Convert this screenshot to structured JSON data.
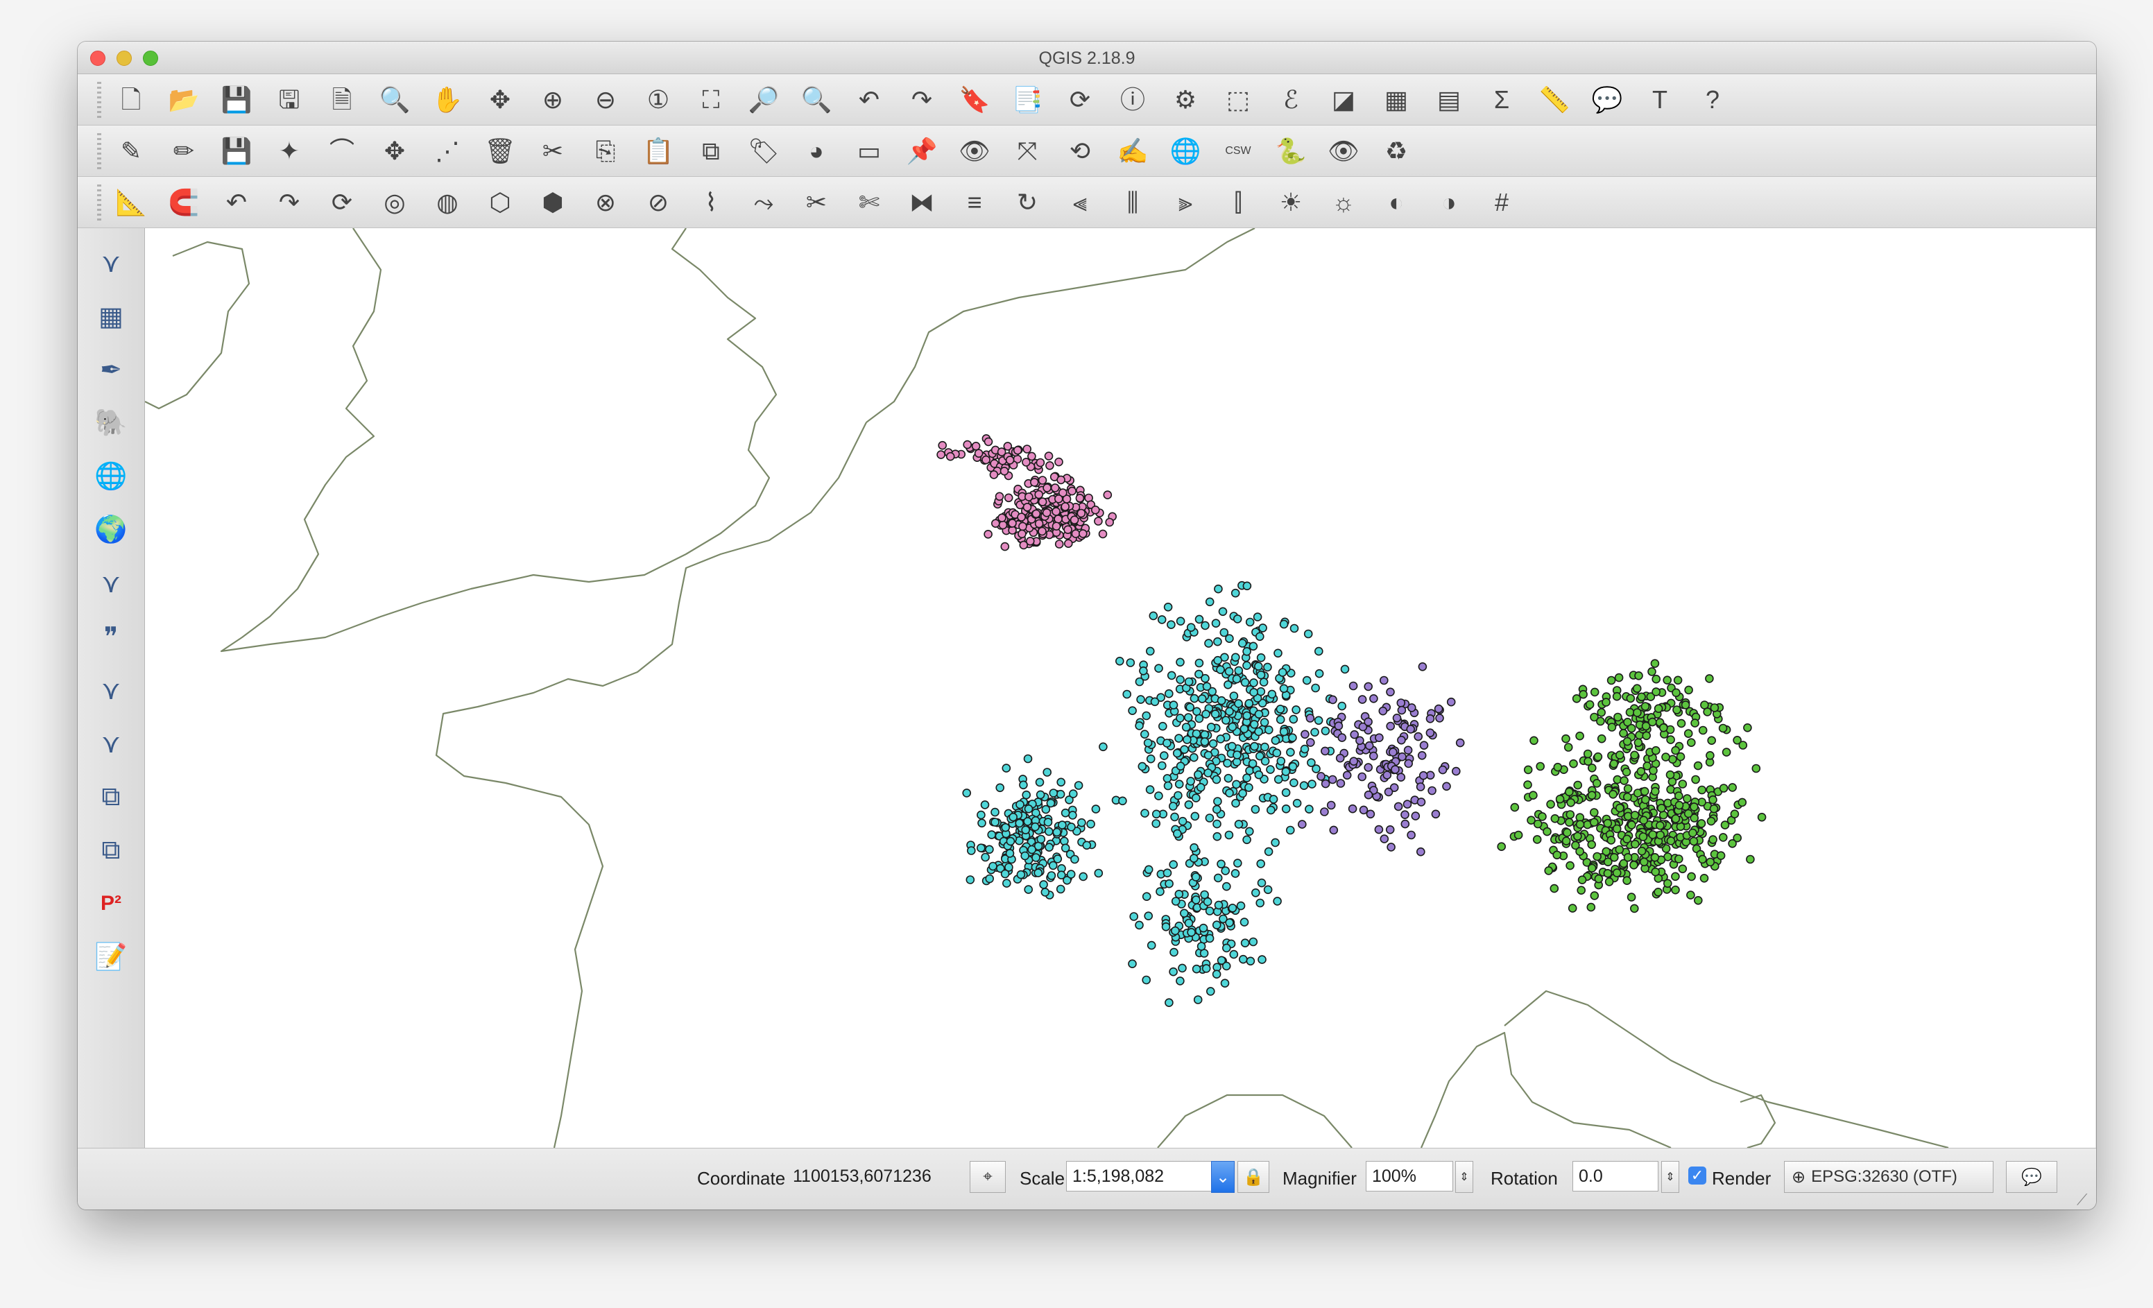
{
  "window": {
    "title": "QGIS 2.18.9"
  },
  "toolbar_file": [
    {
      "name": "new-project-icon",
      "glyph": "🗋"
    },
    {
      "name": "open-project-icon",
      "glyph": "📂"
    },
    {
      "name": "save-project-icon",
      "glyph": "💾"
    },
    {
      "name": "save-as-icon",
      "glyph": "🖫"
    },
    {
      "name": "new-print-composer-icon",
      "glyph": "🗎"
    },
    {
      "name": "composer-manager-icon",
      "glyph": "🔍"
    },
    {
      "name": "pan-map-icon",
      "glyph": "✋"
    },
    {
      "name": "pan-to-selection-icon",
      "glyph": "✥"
    },
    {
      "name": "zoom-in-icon",
      "glyph": "⊕"
    },
    {
      "name": "zoom-out-icon",
      "glyph": "⊖"
    },
    {
      "name": "zoom-native-icon",
      "glyph": "①"
    },
    {
      "name": "zoom-full-icon",
      "glyph": "⛶"
    },
    {
      "name": "zoom-to-selection-icon",
      "glyph": "🔎"
    },
    {
      "name": "zoom-to-layer-icon",
      "glyph": "🔍"
    },
    {
      "name": "zoom-last-icon",
      "glyph": "↶"
    },
    {
      "name": "zoom-next-icon",
      "glyph": "↷"
    },
    {
      "name": "new-bookmark-icon",
      "glyph": "🔖"
    },
    {
      "name": "show-bookmarks-icon",
      "glyph": "📑"
    },
    {
      "name": "refresh-icon",
      "glyph": "⟳"
    },
    {
      "name": "identify-icon",
      "glyph": "ⓘ"
    },
    {
      "name": "run-feature-action-icon",
      "glyph": "⚙"
    },
    {
      "name": "select-features-icon",
      "glyph": "⬚"
    },
    {
      "name": "select-by-expression-icon",
      "glyph": "ℰ"
    },
    {
      "name": "deselect-all-icon",
      "glyph": "◪"
    },
    {
      "name": "attribute-table-icon",
      "glyph": "▦"
    },
    {
      "name": "field-calculator-icon",
      "glyph": "▤"
    },
    {
      "name": "statistics-icon",
      "glyph": "Σ"
    },
    {
      "name": "measure-icon",
      "glyph": "📏"
    },
    {
      "name": "map-tips-icon",
      "glyph": "💬"
    },
    {
      "name": "text-annotation-icon",
      "glyph": "T"
    },
    {
      "name": "help-icon",
      "glyph": "?"
    }
  ],
  "toolbar_edit": [
    {
      "name": "current-edits-icon",
      "glyph": "✎"
    },
    {
      "name": "toggle-editing-icon",
      "glyph": "✏"
    },
    {
      "name": "save-edits-icon",
      "glyph": "💾"
    },
    {
      "name": "add-feature-icon",
      "glyph": "✦"
    },
    {
      "name": "add-circular-string-icon",
      "glyph": "⌒"
    },
    {
      "name": "move-feature-icon",
      "glyph": "✥"
    },
    {
      "name": "node-tool-icon",
      "glyph": "⋰"
    },
    {
      "name": "delete-selected-icon",
      "glyph": "🗑"
    },
    {
      "name": "cut-features-icon",
      "glyph": "✂"
    },
    {
      "name": "copy-features-icon",
      "glyph": "⎘"
    },
    {
      "name": "paste-features-icon",
      "glyph": "📋"
    },
    {
      "name": "digitize-with-segment-icon",
      "glyph": "⧉"
    },
    {
      "name": "label-tool-icon",
      "glyph": "🏷"
    },
    {
      "name": "diagram-icon",
      "glyph": "◕"
    },
    {
      "name": "highlight-label-icon",
      "glyph": "▭"
    },
    {
      "name": "pin-labels-icon",
      "glyph": "📌"
    },
    {
      "name": "show-hide-labels-icon",
      "glyph": "👁"
    },
    {
      "name": "move-label-icon",
      "glyph": "⤧"
    },
    {
      "name": "rotate-label-icon",
      "glyph": "⟲"
    },
    {
      "name": "change-label-icon",
      "glyph": "✍"
    },
    {
      "name": "metasearch-icon",
      "glyph": "🌐"
    },
    {
      "name": "csw-icon",
      "glyph": "CSW"
    },
    {
      "name": "python-console-icon",
      "glyph": "🐍"
    },
    {
      "name": "eye-icon",
      "glyph": "👁"
    },
    {
      "name": "plugin-sync-icon",
      "glyph": "♻"
    }
  ],
  "toolbar_advanced": [
    {
      "name": "snapping-icon",
      "glyph": "📐"
    },
    {
      "name": "magnet-icon",
      "glyph": "🧲"
    },
    {
      "name": "undo-icon",
      "glyph": "↶"
    },
    {
      "name": "redo-icon",
      "glyph": "↷"
    },
    {
      "name": "rotate-feature-icon",
      "glyph": "⟳"
    },
    {
      "name": "simplify-feature-icon",
      "glyph": "◎"
    },
    {
      "name": "add-ring-icon",
      "glyph": "◍"
    },
    {
      "name": "add-part-icon",
      "glyph": "⬡"
    },
    {
      "name": "fill-ring-icon",
      "glyph": "⬢"
    },
    {
      "name": "delete-ring-icon",
      "glyph": "⊗"
    },
    {
      "name": "delete-part-icon",
      "glyph": "⊘"
    },
    {
      "name": "reshape-features-icon",
      "glyph": "⌇"
    },
    {
      "name": "offset-curve-icon",
      "glyph": "⤳"
    },
    {
      "name": "split-features-icon",
      "glyph": "✂"
    },
    {
      "name": "split-parts-icon",
      "glyph": "✄"
    },
    {
      "name": "merge-features-icon",
      "glyph": "⧓"
    },
    {
      "name": "merge-attributes-icon",
      "glyph": "≡"
    },
    {
      "name": "rotate-point-symbols-icon",
      "glyph": "↻"
    },
    {
      "name": "align-left-icon",
      "glyph": "⫷"
    },
    {
      "name": "align-center-icon",
      "glyph": "⫼"
    },
    {
      "name": "align-right-icon",
      "glyph": "⫸"
    },
    {
      "name": "distribute-icon",
      "glyph": "⫿"
    },
    {
      "name": "sun-add-icon",
      "glyph": "☀"
    },
    {
      "name": "sun-remove-icon",
      "glyph": "☼"
    },
    {
      "name": "geo-add-icon",
      "glyph": "◐"
    },
    {
      "name": "geo-remove-icon",
      "glyph": "◑"
    },
    {
      "name": "grid-icon",
      "glyph": "#"
    }
  ],
  "sidebar": [
    {
      "name": "add-vector-layer-icon",
      "glyph": "⋎"
    },
    {
      "name": "add-raster-layer-icon",
      "glyph": "▦"
    },
    {
      "name": "add-spatialite-layer-icon",
      "glyph": "✒"
    },
    {
      "name": "add-postgis-layer-icon",
      "glyph": "🐘"
    },
    {
      "name": "add-wms-layer-icon",
      "glyph": "🌐"
    },
    {
      "name": "add-wcs-layer-icon",
      "glyph": "🌍"
    },
    {
      "name": "add-wfs-layer-icon",
      "glyph": "⋎"
    },
    {
      "name": "add-delimited-text-icon",
      "glyph": "❞"
    },
    {
      "name": "add-virtual-layer-icon",
      "glyph": "⋎"
    },
    {
      "name": "new-shapefile-icon",
      "glyph": "⋎"
    },
    {
      "name": "new-spatialite-icon",
      "glyph": "⧉"
    },
    {
      "name": "new-geopackage-icon",
      "glyph": "⧉"
    },
    {
      "name": "p2-plugin-icon",
      "glyph": "P²"
    },
    {
      "name": "notes-icon",
      "glyph": "📝"
    }
  ],
  "status": {
    "coordinate_label": "Coordinate",
    "coordinate_value": "1100153,6071236",
    "scale_label": "Scale",
    "scale_value": "1:5,198,082",
    "magnifier_label": "Magnifier",
    "magnifier_value": "100%",
    "rotation_label": "Rotation",
    "rotation_value": "0.0",
    "render_label": "Render",
    "render_checked": true,
    "crs": "EPSG:32630 (OTF)"
  },
  "map": {
    "background": "#ffffff",
    "coast_color": "#7a8868",
    "layers": [
      {
        "name": "pink-cluster",
        "color": "#e48cc2"
      },
      {
        "name": "cyan-cluster",
        "color": "#4fd6d8"
      },
      {
        "name": "purple-cluster",
        "color": "#9a7ed1"
      },
      {
        "name": "green-cluster",
        "color": "#5cc43e"
      }
    ]
  }
}
